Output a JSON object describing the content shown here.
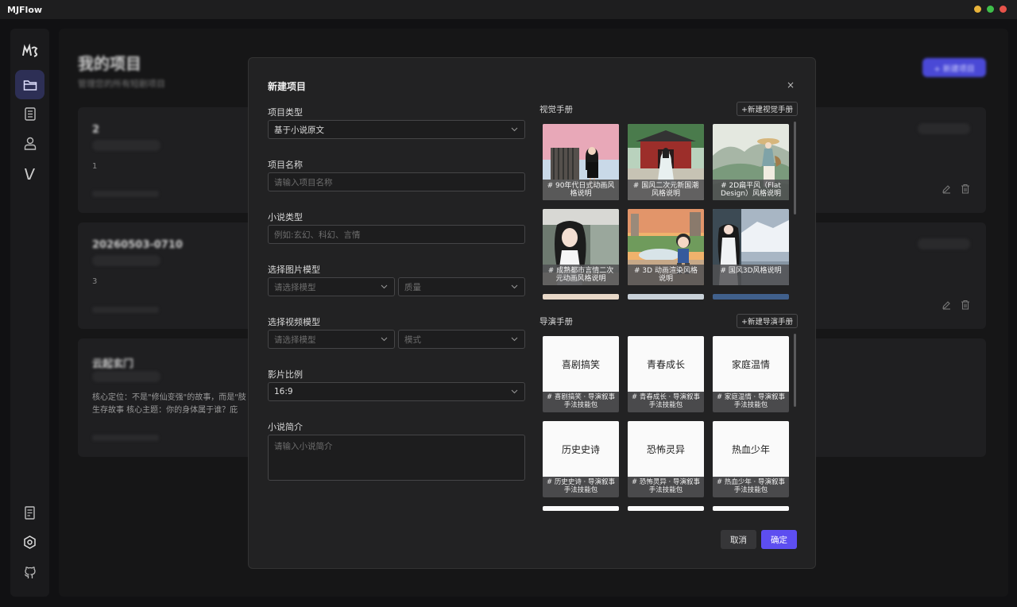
{
  "app": {
    "title": "MJFlow",
    "window_dots": [
      "#e8b33a",
      "#3fbf4a",
      "#e8534a"
    ]
  },
  "sidebar": {
    "logo": "mj-logo-icon",
    "items": [
      {
        "icon": "folder-icon",
        "active": true
      },
      {
        "icon": "document-list-icon",
        "active": false
      },
      {
        "icon": "user-icon",
        "active": false
      },
      {
        "icon": "v-logo-icon",
        "active": false
      }
    ],
    "bottom": [
      "receipt-icon",
      "settings-hexagon-icon",
      "github-icon"
    ]
  },
  "background_page": {
    "title": "我的项目",
    "subtitle": "管理您的所有短剧项目",
    "cards": [
      {
        "title": "2",
        "desc": "1"
      },
      {
        "title": "20260503-0710",
        "desc": "3"
      },
      {
        "title": "云起玄门",
        "desc": "核心定位：不是\"修仙变强\"的故事，而是\"肢 生存故事 核心主题：你的身体属于谁？庇"
      }
    ]
  },
  "modal": {
    "title": "新建项目",
    "close": "×",
    "fields": {
      "project_type_label": "项目类型",
      "project_type_value": "基于小说原文",
      "project_name_label": "项目名称",
      "project_name_placeholder": "请输入项目名称",
      "novel_type_label": "小说类型",
      "novel_type_placeholder": "例如:玄幻、科幻、言情",
      "image_model_label": "选择图片模型",
      "image_model_placeholder": "请选择模型",
      "image_quality_placeholder": "质量",
      "video_model_label": "选择视频模型",
      "video_model_placeholder": "请选择模型",
      "video_mode_placeholder": "模式",
      "ratio_label": "影片比例",
      "ratio_value": "16:9",
      "synopsis_label": "小说简介",
      "synopsis_placeholder": "请输入小说简介"
    },
    "visual_handbook": {
      "label": "视觉手册",
      "add_button": "+新建视觉手册",
      "items": [
        {
          "caption": "# 90年代日式动画风格说明"
        },
        {
          "caption": "# 国风二次元新国潮风格说明"
        },
        {
          "caption": "# 2D扁平风（Flat Design）风格说明"
        },
        {
          "caption": "# 成熟都市言情二次元动画风格说明"
        },
        {
          "caption": "# 3D 动画渲染风格说明"
        },
        {
          "caption": "# 国风3D风格说明"
        }
      ]
    },
    "director_handbook": {
      "label": "导演手册",
      "add_button": "+新建导演手册",
      "items": [
        {
          "title": "喜剧搞笑",
          "caption": "# 喜剧搞笑 · 导演叙事手法技能包"
        },
        {
          "title": "青春成长",
          "caption": "# 青春成长 · 导演叙事手法技能包"
        },
        {
          "title": "家庭温情",
          "caption": "# 家庭温情 · 导演叙事手法技能包"
        },
        {
          "title": "历史史诗",
          "caption": "# 历史史诗 · 导演叙事手法技能包"
        },
        {
          "title": "恐怖灵异",
          "caption": "# 恐怖灵异 · 导演叙事手法技能包"
        },
        {
          "title": "热血少年",
          "caption": "# 热血少年 · 导演叙事手法技能包"
        }
      ]
    },
    "cancel": "取消",
    "confirm": "确定",
    "accent": "#5d4ef0"
  }
}
